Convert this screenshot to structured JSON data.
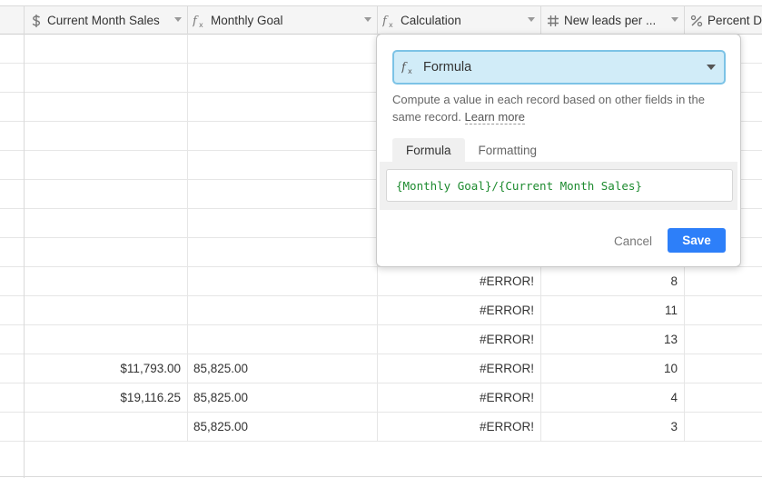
{
  "columns": [
    {
      "name": "Current Month Sales",
      "icon": "dollar-icon"
    },
    {
      "name": "Monthly Goal",
      "icon": "formula-icon"
    },
    {
      "name": "Calculation",
      "icon": "formula-icon"
    },
    {
      "name": "New leads per ...",
      "icon": "hash-icon"
    },
    {
      "name": "Percent D",
      "icon": "percent-icon"
    }
  ],
  "rows": [
    {
      "sales": "",
      "goal": "",
      "calc": "",
      "leads": ""
    },
    {
      "sales": "",
      "goal": "",
      "calc": "",
      "leads": ""
    },
    {
      "sales": "",
      "goal": "",
      "calc": "",
      "leads": ""
    },
    {
      "sales": "",
      "goal": "",
      "calc": "",
      "leads": ""
    },
    {
      "sales": "",
      "goal": "",
      "calc": "",
      "leads": ""
    },
    {
      "sales": "",
      "goal": "",
      "calc": "",
      "leads": ""
    },
    {
      "sales": "",
      "goal": "",
      "calc": "",
      "leads": ""
    },
    {
      "sales": "",
      "goal": "",
      "calc": "",
      "leads": ""
    },
    {
      "sales": "",
      "goal": "",
      "calc": "#ERROR!",
      "leads": "8"
    },
    {
      "sales": "",
      "goal": "",
      "calc": "#ERROR!",
      "leads": "11"
    },
    {
      "sales": "",
      "goal": "",
      "calc": "#ERROR!",
      "leads": "13"
    },
    {
      "sales": "$11,793.00",
      "goal": "85,825.00",
      "calc": "#ERROR!",
      "leads": "10"
    },
    {
      "sales": "$19,116.25",
      "goal": "85,825.00",
      "calc": "#ERROR!",
      "leads": "4"
    },
    {
      "sales": "",
      "goal": "85,825.00",
      "calc": "#ERROR!",
      "leads": "3"
    }
  ],
  "popover": {
    "field_type": "Formula",
    "description": "Compute a value in each record based on other fields in the same record.",
    "learn_more": "Learn more",
    "tabs": [
      "Formula",
      "Formatting"
    ],
    "formula": "{Monthly Goal}/{Current Month Sales}",
    "cancel_label": "Cancel",
    "save_label": "Save"
  },
  "colors": {
    "accent": "#2d7ff9",
    "select_bg": "#d1ecf8",
    "formula_text": "#1c8a2e"
  }
}
